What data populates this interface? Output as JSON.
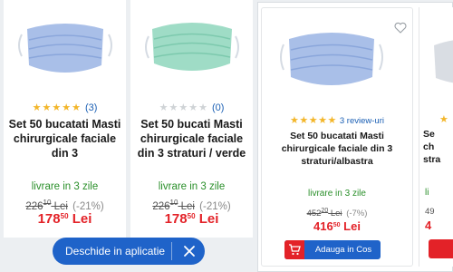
{
  "colors": {
    "accent_blue": "#1f63c9",
    "price_red": "#e32228",
    "delivery_green": "#2a8f2a",
    "star_gold": "#f3b62a"
  },
  "mobile_products": [
    {
      "rating_count": "(3)",
      "stars_filled": 5,
      "title": "Set 50 bucatati Masti chirurgicale faciale din 3",
      "delivery": "livrare in 3 zile",
      "old_price_int": "226",
      "old_price_dec": "10",
      "old_price_cur": "Lei",
      "discount": "(-21%)",
      "price_int": "178",
      "price_dec": "50",
      "price_cur": "Lei",
      "mask_color": "blue"
    },
    {
      "rating_count": "(0)",
      "stars_filled": 0,
      "title": "Set 50 bucati Masti chirurgicale faciale din 3 straturi / verde",
      "delivery": "livrare in 3 zile",
      "old_price_int": "226",
      "old_price_dec": "10",
      "old_price_cur": "Lei",
      "discount": "(-21%)",
      "price_int": "178",
      "price_dec": "50",
      "price_cur": "Lei",
      "mask_color": "green"
    }
  ],
  "app_banner": {
    "label": "Deschide in aplicatie",
    "close_icon": "close-icon"
  },
  "desktop_product": {
    "stars_filled": 5,
    "rating_link": "3 review-uri",
    "title": "Set 50 bucatati Masti chirurgicale faciale din 3 straturi/albastra",
    "delivery": "livrare in 3 zile",
    "old_price_int": "452",
    "old_price_dec": "20",
    "old_price_cur": "Lei",
    "discount": "(-7%)",
    "price_int": "416",
    "price_dec": "50",
    "price_cur": "Lei",
    "cart_button": "Adauga in Cos",
    "favorite_icon": "heart-icon"
  },
  "desktop_partial": {
    "title_line1": "Se",
    "title_line2": "ch",
    "title_line3": "stra",
    "delivery": "li",
    "old_price": "49",
    "price": "4"
  }
}
